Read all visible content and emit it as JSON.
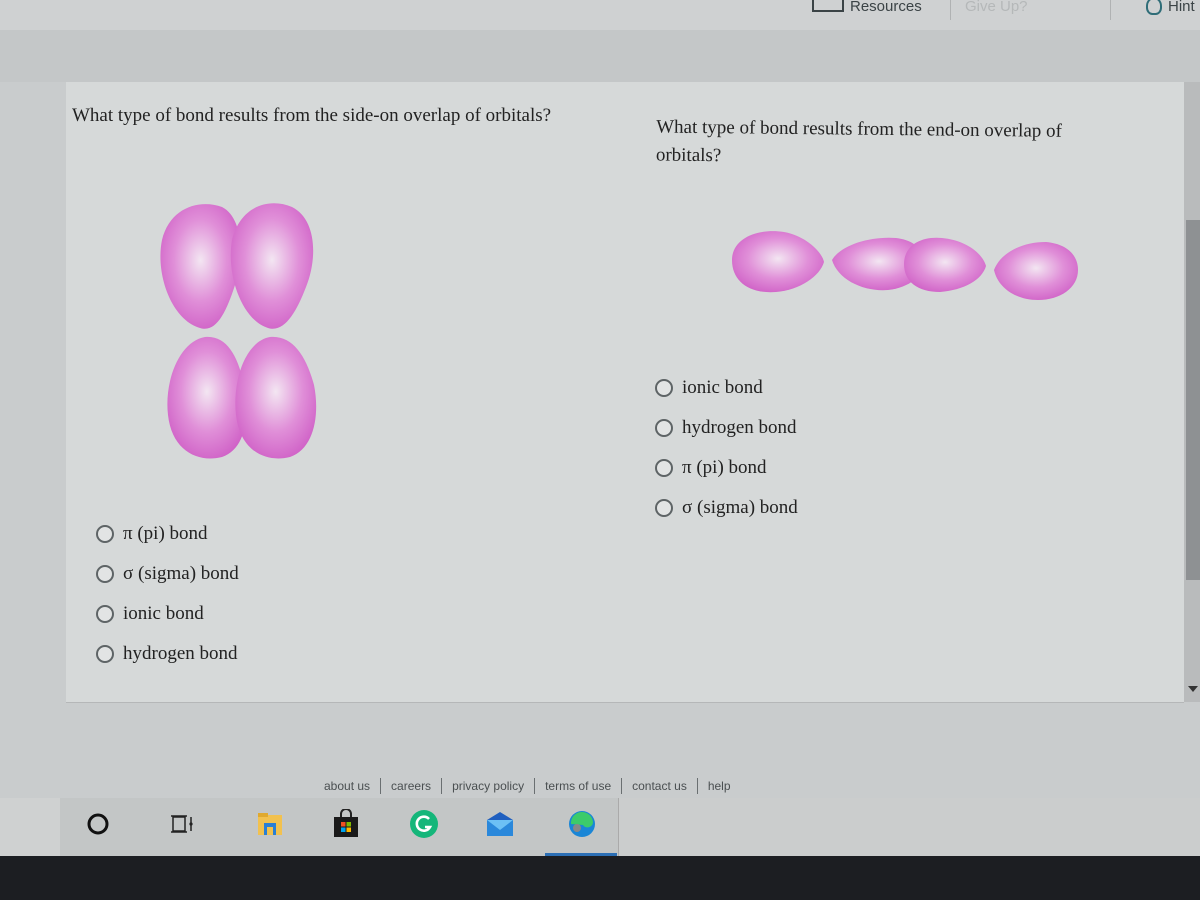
{
  "topbar": {
    "resources_label": "Resources",
    "giveup_label": "Give Up?",
    "hint_label": "Hint"
  },
  "questions": [
    {
      "text": "What type of bond results from the side-on overlap of orbitals?",
      "diagram": "side-on overlap of two p orbitals",
      "options": [
        {
          "label": "π (pi) bond",
          "selected": false
        },
        {
          "label": "σ (sigma) bond",
          "selected": false
        },
        {
          "label": "ionic bond",
          "selected": false
        },
        {
          "label": "hydrogen bond",
          "selected": false
        }
      ]
    },
    {
      "text": "What type of bond results from the end-on overlap of orbitals?",
      "diagram": "end-on overlap of two p orbitals",
      "options": [
        {
          "label": "ionic bond",
          "selected": false
        },
        {
          "label": "hydrogen bond",
          "selected": false
        },
        {
          "label": "π (pi) bond",
          "selected": false
        },
        {
          "label": "σ (sigma) bond",
          "selected": false
        }
      ]
    }
  ],
  "colors": {
    "orbital": "#d46fcd",
    "orbital_highlight": "#f3e6f2"
  },
  "footer": {
    "links": [
      "about us",
      "careers",
      "privacy policy",
      "terms of use",
      "contact us",
      "help"
    ]
  },
  "taskbar": {
    "icons": [
      "search-circle-icon",
      "task-view-icon",
      "file-explorer-icon",
      "microsoft-store-icon",
      "grammarly-icon",
      "mail-icon",
      "edge-icon"
    ]
  }
}
